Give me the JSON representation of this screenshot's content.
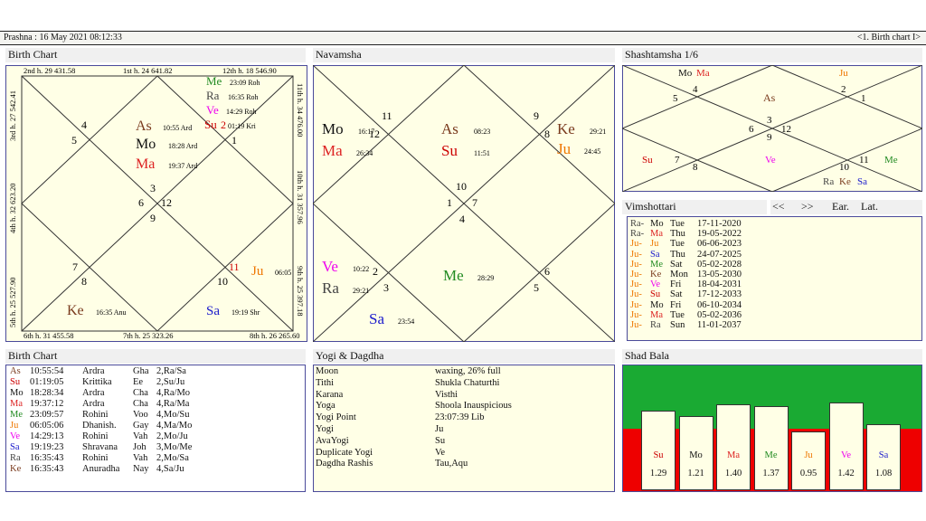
{
  "top": {
    "left": "Prashna :   16 May 2021  08:12:33",
    "right": "<1. Birth chart I>"
  },
  "headers": {
    "birth_chart": "Birth Chart",
    "navamsha": "Navamsha",
    "shashtamsha": "Shashtamsha 1/6",
    "vimshottari": "Vimshottari",
    "birth_table": "Birth Chart",
    "yogi": "Yogi & Dagdha",
    "shad_bala": "Shad Bala"
  },
  "vimshottari_nav": {
    "prev": "<<",
    "next": ">>",
    "ear": "Ear.",
    "lat": "Lat."
  },
  "colors": {
    "As": "#7a3b1e",
    "Su": "#cc0000",
    "Mo": "#111111",
    "Ma": "#dd2222",
    "Me": "#228b22",
    "Ju": "#ee7700",
    "Ve": "#ee00ee",
    "Sa": "#1a1acc",
    "Ra": "#444444",
    "Ke": "#7a3b1e",
    "bala_top": "#1aaa33",
    "bala_bottom": "#ee0000"
  },
  "birth_chart_labels": {
    "house_tags": {
      "h2": "2nd h.  29  431.58",
      "h1": "1st h.  24  641.82",
      "h12": "12th h.  18  546.90",
      "h3": "3rd h.  27  542.41",
      "h11": "11th h.  34  476.00",
      "h4": "4th h.  32  623.20",
      "h10": "10th h.  31  357.96",
      "h5": "5th h.  25  527.90",
      "h9": "9th h.  25  397.18",
      "h6": "6th h.  31  455.58",
      "h7": "7th h.  25  323.26",
      "h8": "8th h.  26  265.60"
    },
    "signs": {
      "s4": "4",
      "s5": "5",
      "s2": "2",
      "s1": "1",
      "s3": "3",
      "s6": "6",
      "s12": "12",
      "s9": "9",
      "s7": "7",
      "s8": "8",
      "s11": "11",
      "s10": "10"
    },
    "planets": {
      "me": "Me",
      "me_t": "23:09  Roh",
      "ra": "Ra",
      "ra_t": "16:35  Roh",
      "ve": "Ve",
      "ve_t": "14:29  Roh",
      "su": "Su",
      "su_t": "01:19  Kri",
      "as": "As",
      "as_t": "10:55  Ard",
      "mo": "Mo",
      "mo_t": "18:28  Ard",
      "ma": "Ma",
      "ma_t": "19:37  Ard",
      "ke": "Ke",
      "ke_t": "16:35  Anu",
      "ju": "Ju",
      "ju_t": "06:05",
      "sa": "Sa",
      "sa_t": "19:19  Shr"
    }
  },
  "navamsha_labels": {
    "signs": {
      "n11": "11",
      "n12": "12",
      "n9": "9",
      "n8": "8",
      "n10": "10",
      "n1": "1",
      "n7": "7",
      "n4": "4",
      "n2": "2",
      "n3": "3",
      "n6": "6",
      "n5": "5"
    },
    "planets": {
      "mo": "Mo",
      "mo_t": "16:17",
      "ma": "Ma",
      "ma_t": "26:34",
      "as": "As",
      "as_t": "08:23",
      "su": "Su",
      "su_t": "11:51",
      "ke": "Ke",
      "ke_t": "29:21",
      "ju": "Ju",
      "ju_t": "24:45",
      "ve": "Ve",
      "ve_t": "10:22",
      "ra": "Ra",
      "ra_t": "29:21",
      "me": "Me",
      "me_t": "28:29",
      "sa": "Sa",
      "sa_t": "23:54"
    }
  },
  "shashtamsha_labels": {
    "mo": "Mo",
    "ma": "Ma",
    "ju": "Ju",
    "as": "As",
    "su": "Su",
    "ve": "Ve",
    "me": "Me",
    "ra": "Ra",
    "ke": "Ke",
    "sa": "Sa",
    "s4": "4",
    "s5": "5",
    "s2": "2",
    "s1": "1",
    "s3": "3",
    "s6": "6",
    "s12": "12",
    "s9": "9",
    "s7": "7",
    "s8": "8",
    "s11": "11",
    "s10": "10"
  },
  "vimshottari": [
    {
      "dasha": "Ra-",
      "bhukti": "Mo",
      "day": "Tue",
      "date": "17-11-2020"
    },
    {
      "dasha": "Ra-",
      "bhukti": "Ma",
      "day": "Thu",
      "date": "19-05-2022"
    },
    {
      "dasha": "Ju-",
      "bhukti": "Ju",
      "day": "Tue",
      "date": "06-06-2023"
    },
    {
      "dasha": "Ju-",
      "bhukti": "Sa",
      "day": "Thu",
      "date": "24-07-2025"
    },
    {
      "dasha": "Ju-",
      "bhukti": "Me",
      "day": "Sat",
      "date": "05-02-2028"
    },
    {
      "dasha": "Ju-",
      "bhukti": "Ke",
      "day": "Mon",
      "date": "13-05-2030"
    },
    {
      "dasha": "Ju-",
      "bhukti": "Ve",
      "day": "Fri",
      "date": "18-04-2031"
    },
    {
      "dasha": "Ju-",
      "bhukti": "Su",
      "day": "Sat",
      "date": "17-12-2033"
    },
    {
      "dasha": "Ju-",
      "bhukti": "Mo",
      "day": "Fri",
      "date": "06-10-2034"
    },
    {
      "dasha": "Ju-",
      "bhukti": "Ma",
      "day": "Tue",
      "date": "05-02-2036"
    },
    {
      "dasha": "Ju-",
      "bhukti": "Ra",
      "day": "Sun",
      "date": "11-01-2037"
    }
  ],
  "birth_table": [
    {
      "p": "As",
      "time": "10:55:54",
      "nak": "Ardra",
      "sy": "Gha",
      "pada": "2,Ra/Sa"
    },
    {
      "p": "Su",
      "time": "01:19:05",
      "nak": "Krittika",
      "sy": "Ee",
      "pada": "2,Su/Ju"
    },
    {
      "p": "Mo",
      "time": "18:28:34",
      "nak": "Ardra",
      "sy": "Cha",
      "pada": "4,Ra/Mo"
    },
    {
      "p": "Ma",
      "time": "19:37:12",
      "nak": "Ardra",
      "sy": "Cha",
      "pada": "4,Ra/Ma"
    },
    {
      "p": "Me",
      "time": "23:09:57",
      "nak": "Rohini",
      "sy": "Voo",
      "pada": "4,Mo/Su"
    },
    {
      "p": "Ju",
      "time": "06:05:06",
      "nak": "Dhanish.",
      "sy": "Gay",
      "pada": "4,Ma/Mo"
    },
    {
      "p": "Ve",
      "time": "14:29:13",
      "nak": "Rohini",
      "sy": "Vah",
      "pada": "2,Mo/Ju"
    },
    {
      "p": "Sa",
      "time": "19:19:23",
      "nak": "Shravana",
      "sy": "Joh",
      "pada": "3,Mo/Me"
    },
    {
      "p": "Ra",
      "time": "16:35:43",
      "nak": "Rohini",
      "sy": "Vah",
      "pada": "2,Mo/Sa"
    },
    {
      "p": "Ke",
      "time": "16:35:43",
      "nak": "Anuradha",
      "sy": "Nay",
      "pada": "4,Sa/Ju"
    }
  ],
  "yogi": [
    {
      "k": "Moon",
      "v": "waxing, 26% full"
    },
    {
      "k": "Tithi",
      "v": "Shukla  Chaturthi"
    },
    {
      "k": "Karana",
      "v": "Visthi"
    },
    {
      "k": "Yoga",
      "v": "Shoola Inauspicious"
    },
    {
      "k": "Yogi Point",
      "v": "23:07:39 Lib"
    },
    {
      "k": "Yogi",
      "v": "Ju"
    },
    {
      "k": "AvaYogi",
      "v": "Su"
    },
    {
      "k": "Duplicate Yogi",
      "v": "Ve"
    },
    {
      "k": "Dagdha Rashis",
      "v": "Tau,Aqu"
    }
  ],
  "shad_bala": [
    {
      "p": "Su",
      "v": "1.29"
    },
    {
      "p": "Mo",
      "v": "1.21"
    },
    {
      "p": "Ma",
      "v": "1.40"
    },
    {
      "p": "Me",
      "v": "1.37"
    },
    {
      "p": "Ju",
      "v": "0.95"
    },
    {
      "p": "Ve",
      "v": "1.42"
    },
    {
      "p": "Sa",
      "v": "1.08"
    }
  ]
}
